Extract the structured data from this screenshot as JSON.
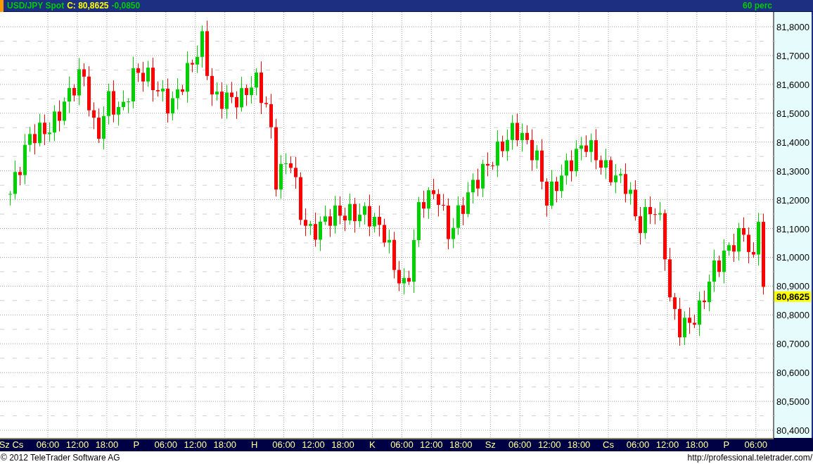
{
  "header": {
    "symbol": "USD/JPY Spot",
    "close": "C: 80,8625",
    "change": "-0,0850",
    "interval": "60 perc"
  },
  "y_axis": {
    "labels": [
      "81,8000",
      "81,7000",
      "81,6000",
      "81,5000",
      "81,4000",
      "81,3000",
      "81,2000",
      "81,1000",
      "81,0000",
      "80,9000",
      "80,8000",
      "80,7000",
      "80,6000",
      "80,5000",
      "80,4000"
    ],
    "current_price": "80,8625"
  },
  "x_axis": {
    "labels": [
      "Sz Cs",
      "06:00",
      "12:00",
      "18:00",
      "P",
      "06:00",
      "12:00",
      "18:00",
      "H",
      "06:00",
      "12:00",
      "18:00",
      "K",
      "06:00",
      "12:00",
      "18:00",
      "Sz",
      "06:00",
      "12:00",
      "18:00",
      "Cs",
      "06:00",
      "12:00",
      "18:00",
      "P",
      "06:00"
    ]
  },
  "footer": {
    "copyright": "© 2012 TeleTrader Software AG",
    "url": "http://professional.teletrader.com/"
  }
}
